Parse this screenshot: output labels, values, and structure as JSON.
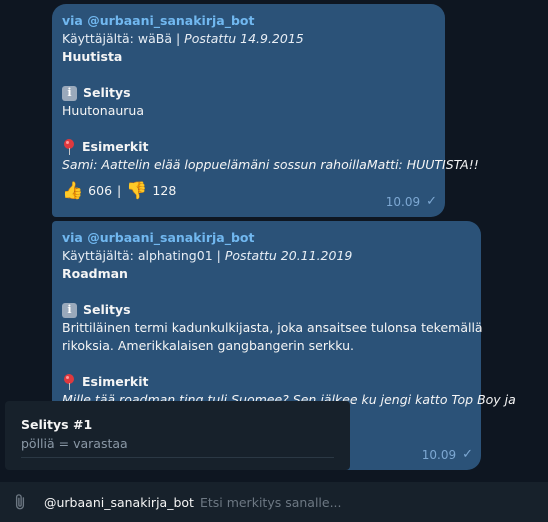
{
  "messages": [
    {
      "via": "via @urbaani_sanakirja_bot",
      "user_label": "Käyttäjältä:",
      "user": "wäBä",
      "separator": "|",
      "posted": "Postattu 14.9.2015",
      "word": "Huutista",
      "definition_header": "Selitys",
      "definition": "Huutonaurua",
      "examples_header": "Esimerkit",
      "example": "Sami: Aattelin elää loppuelämäni sossun rahoillaMatti: HUUTISTA!!",
      "likes": "606",
      "dislikes": "128",
      "time": "10.09"
    },
    {
      "via": "via @urbaani_sanakirja_bot",
      "user_label": "Käyttäjältä:",
      "user": "alphating01",
      "separator": "|",
      "posted": "Postattu 20.11.2019",
      "word": "Roadman",
      "definition_header": "Selitys",
      "definition_line1": "Brittiläinen termi kadunkulkijasta, joka ansaitsee tulonsa tekemällä",
      "definition_line2": "rikoksia. Amerikkalaisen gangbangerin serkku.",
      "examples_header": "Esimerkit",
      "example_partial": "Mille tää roadman ting tuli Suomee? Sen jälkee ku jengi katto Top Boy ja",
      "time": "10.09"
    }
  ],
  "popup": {
    "title": "Selitys #1",
    "text": "pölliä = varastaa"
  },
  "input": {
    "value": "@urbaani_sanakirja_bot",
    "placeholder": "Etsi merkitys sanalle..."
  },
  "icons": {
    "info": "info-icon",
    "pin": "pushpin-icon",
    "like": "thumbs-up-icon",
    "dislike": "thumbs-down-icon",
    "read": "checkmark-icon",
    "attach": "paperclip-icon"
  },
  "colors": {
    "bubble": "#2b5278",
    "background": "#0e1621",
    "panel": "#17212b",
    "link": "#71b8f0"
  }
}
